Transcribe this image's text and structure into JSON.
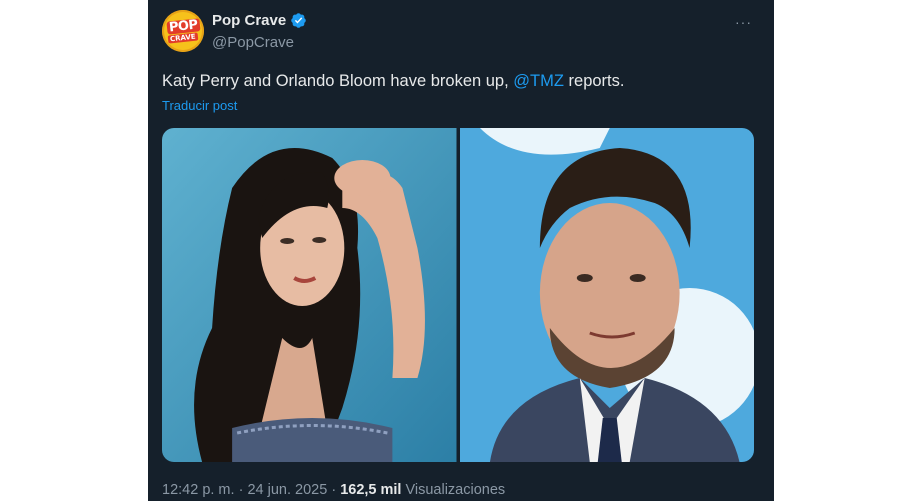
{
  "post": {
    "author": {
      "display_name": "Pop Crave",
      "handle": "@PopCrave",
      "avatar_logo_text": [
        "POP",
        "CRAVE"
      ]
    },
    "text_before": "Katy Perry and Orlando Bloom have broken up, ",
    "mention": "@TMZ",
    "text_after": " reports.",
    "translate_label": "Traducir post",
    "more_menu": "···",
    "images": [
      {
        "icon": "photo-woman-dark-hair"
      },
      {
        "icon": "photo-man-suit"
      }
    ],
    "time": "12:42 p. m.",
    "separator": "·",
    "date": "24 jun. 2025",
    "views_count": "162,5 mil",
    "views_label": "Visualizaciones"
  },
  "colors": {
    "background": "#15202b",
    "text": "#e7e9ea",
    "secondary_text": "#8b98a5",
    "accent": "#1d9bf0"
  }
}
